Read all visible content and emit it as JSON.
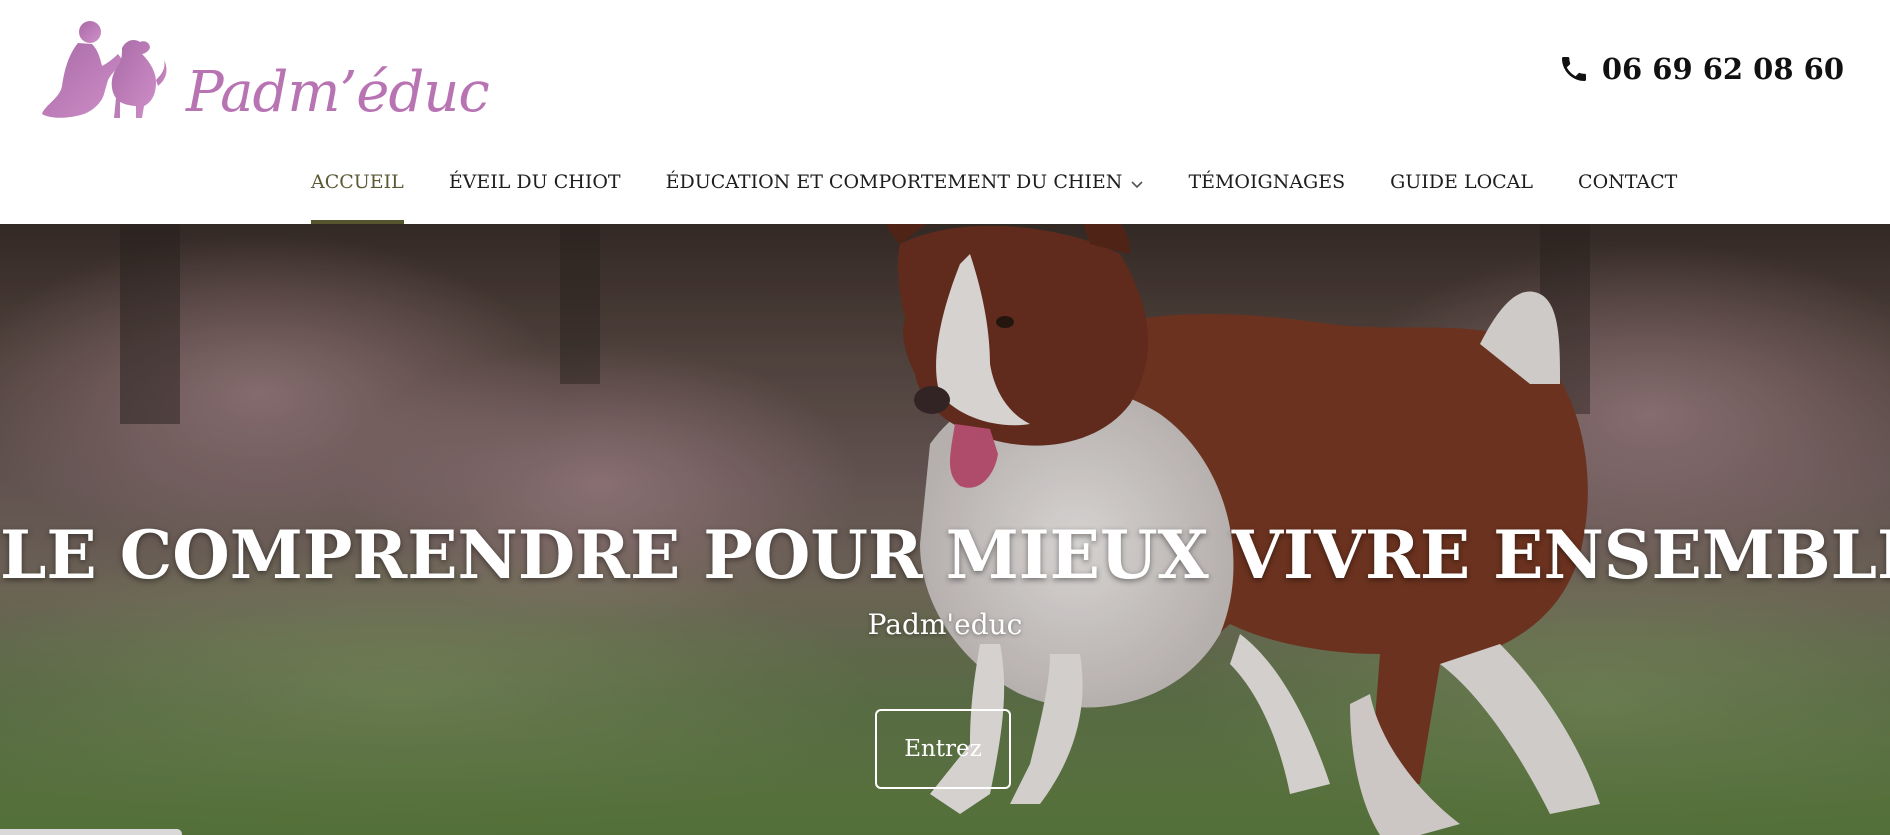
{
  "brand": {
    "name": "Padm’éduc",
    "logo_color": "#b873b2",
    "logo_icon": "person-and-dog-silhouette-icon"
  },
  "header": {
    "phone_icon": "phone-icon",
    "phone_number": "06 69 62 08 60"
  },
  "nav": {
    "items": [
      {
        "label": "ACCUEIL",
        "active": true
      },
      {
        "label": "ÉVEIL DU CHIOT"
      },
      {
        "label": "ÉDUCATION ET COMPORTEMENT DU CHIEN",
        "has_dropdown": true,
        "dropdown_icon": "chevron-down-icon"
      },
      {
        "label": "TÉMOIGNAGES"
      },
      {
        "label": "GUIDE LOCAL"
      },
      {
        "label": "CONTACT"
      }
    ],
    "active_color": "#55552e"
  },
  "hero": {
    "image": "border-collie-running-on-grass-photo",
    "title": "LE COMPRENDRE POUR MIEUX VIVRE ENSEMBLE",
    "subtitle": "Padm'educ",
    "button_label": "Entrez"
  }
}
